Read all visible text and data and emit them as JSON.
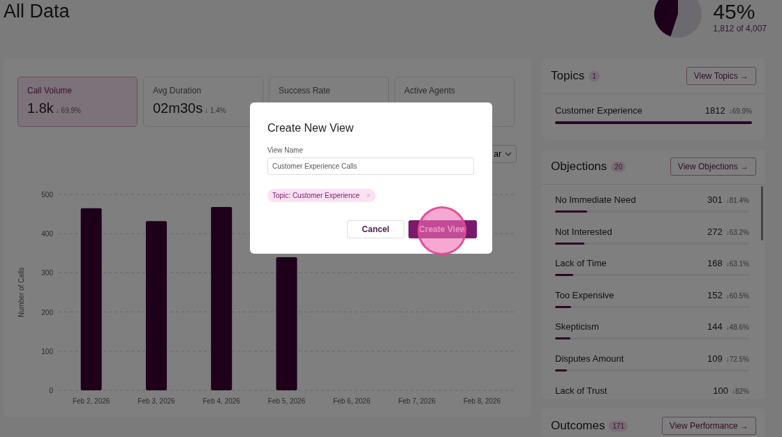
{
  "page": {
    "title": "All Data"
  },
  "summary": {
    "percent": "45%",
    "detail": "1,812 of 4,007"
  },
  "stats": [
    {
      "label": "Call Volume",
      "value": "1.8k",
      "delta": "↓ 69.9%",
      "selected": true
    },
    {
      "label": "Avg Duration",
      "value": "02m30s",
      "delta": "↓ 1.4%",
      "selected": false
    },
    {
      "label": "Success Rate",
      "selected": false
    },
    {
      "label": "Active Agents",
      "selected": false
    }
  ],
  "chart_type_select": {
    "value": "ar"
  },
  "chart_data": {
    "type": "bar",
    "ylabel": "Number of Calls",
    "categories": [
      "Feb 2, 2026",
      "Feb 3, 2026",
      "Feb 4, 2026",
      "Feb 5, 2026",
      "Feb 6, 2026",
      "Feb 7, 2026",
      "Feb 8, 2026"
    ],
    "series": [
      {
        "color": "#3d0034",
        "values": [
          465,
          432,
          468,
          340,
          0,
          0,
          0
        ]
      }
    ],
    "ylim": [
      0,
      500
    ],
    "yticks": [
      0,
      100,
      200,
      300,
      400,
      500
    ],
    "grid": true
  },
  "topics": {
    "title": "Topics",
    "count": "1",
    "button": "View Topics →",
    "items": [
      {
        "name": "Customer Experience",
        "value": "1812",
        "delta": "↓69.9%",
        "level": 1.0
      }
    ]
  },
  "objections": {
    "title": "Objections",
    "count": "20",
    "button": "View Objections →",
    "items": [
      {
        "name": "No Immediate Need",
        "value": "301",
        "delta": "↓81.4%",
        "level": 0.166
      },
      {
        "name": "Not Interested",
        "value": "272",
        "delta": "↓63.2%",
        "level": 0.15
      },
      {
        "name": "Lack of Time",
        "value": "168",
        "delta": "↓63.1%",
        "level": 0.093
      },
      {
        "name": "Too Expensive",
        "value": "152",
        "delta": "↓60.5%",
        "level": 0.084
      },
      {
        "name": "Skepticism",
        "value": "144",
        "delta": "↓48.6%",
        "level": 0.079
      },
      {
        "name": "Disputes Amount",
        "value": "109",
        "delta": "↓72.5%",
        "level": 0.06
      },
      {
        "name": "Lack of Trust",
        "value": "100",
        "delta": "↓82%"
      }
    ]
  },
  "outcomes": {
    "title": "Outcomes",
    "count": "171",
    "button": "View Performance →"
  },
  "dialog": {
    "title": "Create New View",
    "field_label": "View Name",
    "field_value": "Customer Experience Calls",
    "tag": "Topic: Customer Experience",
    "tag_remove": "×",
    "cancel": "Cancel",
    "confirm": "Create View"
  }
}
